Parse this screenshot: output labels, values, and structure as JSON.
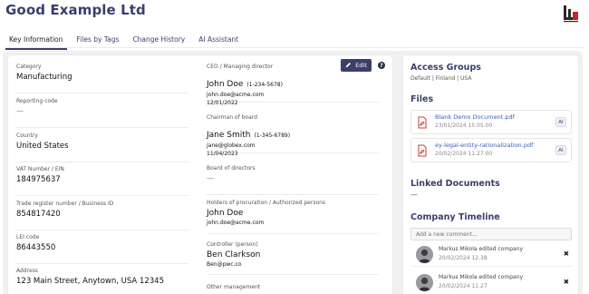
{
  "header": {
    "company_name": "Good Example Ltd",
    "logo_icon": "company-logo"
  },
  "tabs": [
    {
      "label": "Key Information",
      "active": true
    },
    {
      "label": "Files by Tags",
      "active": false
    },
    {
      "label": "Change History",
      "active": false
    },
    {
      "label": "AI Assistant",
      "active": false
    }
  ],
  "colors": {
    "brand": "#3a3f6b",
    "link": "#3a5fb8",
    "panel_bg": "#f1f1f3"
  },
  "actions": {
    "edit_label": "Edit",
    "help_label": "?"
  },
  "left_column": {
    "category": {
      "label": "Category",
      "value": "Manufacturing"
    },
    "reporting_code": {
      "label": "Reporting code",
      "value": "—"
    },
    "country": {
      "label": "Country",
      "value": "United States"
    },
    "vat": {
      "label": "VAT Number / EIN",
      "value": "184975637"
    },
    "trade_register": {
      "label": "Trade register number / Business ID",
      "value": "854817420"
    },
    "lei": {
      "label": "LEI code",
      "value": "86443550"
    },
    "address": {
      "label": "Address",
      "value": "123 Main Street, Anytown, USA 12345"
    }
  },
  "right_column": {
    "ceo": {
      "label": "CEO / Managing director",
      "name": "John Doe",
      "phone": "(1-234-5678)",
      "email": "john.doe@acme.com",
      "date": "12/01/2022"
    },
    "chairman": {
      "label": "Chairman of board",
      "name": "Jane Smith",
      "phone": "(1-345-6789)",
      "email": "jane@globex.com",
      "date": "11/04/2023"
    },
    "board": {
      "label": "Board of directors",
      "value": "—"
    },
    "procuration": {
      "label": "Holders of procuration / Authorized persons",
      "name": "John Doe",
      "email": "john.doe@acme.com"
    },
    "controller": {
      "label": "Controller (person)",
      "name": "Ben Clarkson",
      "email": "Ben@pwc.co"
    },
    "other": {
      "label": "Other management"
    }
  },
  "access_groups": {
    "title": "Access Groups",
    "value": "Default | Finland | USA"
  },
  "files": {
    "title": "Files",
    "items": [
      {
        "name": "Blank Demo Document.pdf",
        "date": "23/01/2024 15.05.00",
        "ai_label": "AI"
      },
      {
        "name": "ey-legal-entity-rationalization.pdf",
        "date": "20/02/2024 11.27.00",
        "ai_label": "AI"
      }
    ]
  },
  "linked_documents": {
    "title": "Linked Documents",
    "value": "—"
  },
  "timeline": {
    "title": "Company Timeline",
    "comment_placeholder": "Add a new comment...",
    "items": [
      {
        "text": "Markus Mikola edited company",
        "date": "20/02/2024 12.38"
      },
      {
        "text": "Markus Mikola edited company",
        "date": "20/02/2024 11.27"
      }
    ]
  }
}
